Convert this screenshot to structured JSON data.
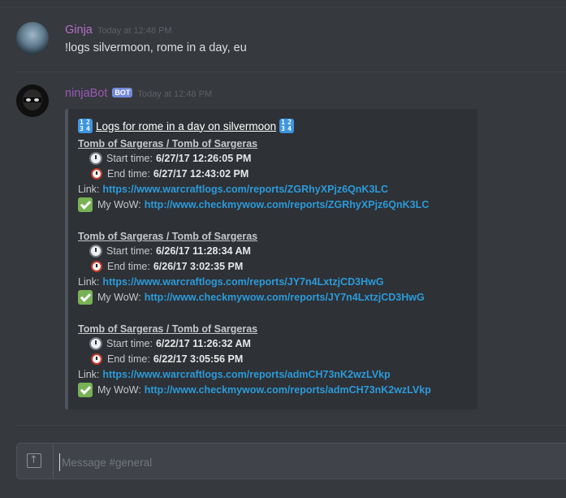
{
  "messages": [
    {
      "author": "Ginja",
      "timestamp": "Today at 12:48 PM",
      "text": "!logs silvermoon, rome in a day, eu"
    },
    {
      "author": "ninjaBot",
      "bot_tag": "BOT",
      "timestamp": "Today at 12:48 PM"
    }
  ],
  "embed": {
    "title": "Logs for rome in a day on silvermoon",
    "title_icon": "input-numbers-icon",
    "title_icon_digits": [
      "1",
      "2",
      "3",
      "4"
    ],
    "start_label": "Start time:",
    "end_label": "End time:",
    "link_label": "Link:",
    "mywow_label": "My WoW:",
    "sections": [
      {
        "title": "Tomb of Sargeras / Tomb of Sargeras",
        "start_time": "6/27/17 12:26:05 PM",
        "end_time": "6/27/17 12:43:02 PM",
        "link": "https://www.warcraftlogs.com/reports/ZGRhyXPjz6QnK3LC",
        "mywow": "http://www.checkmywow.com/reports/ZGRhyXPjz6QnK3LC"
      },
      {
        "title": "Tomb of Sargeras / Tomb of Sargeras",
        "start_time": "6/26/17 11:28:34 AM",
        "end_time": "6/26/17 3:02:35 PM",
        "link": "https://www.warcraftlogs.com/reports/JY7n4LxtzjCD3HwG",
        "mywow": "http://www.checkmywow.com/reports/JY7n4LxtzjCD3HwG"
      },
      {
        "title": "Tomb of Sargeras / Tomb of Sargeras",
        "start_time": "6/22/17 11:26:32 AM",
        "end_time": "6/22/17 3:05:56 PM",
        "link": "https://www.warcraftlogs.com/reports/admCH73nK2wzLVkp",
        "mywow": "http://www.checkmywow.com/reports/admCH73nK2wzLVkp"
      }
    ]
  },
  "composer": {
    "placeholder": "Message #general"
  },
  "colors": {
    "background": "#36393e",
    "link": "#2c9ad8",
    "bot_tag": "#7289da",
    "author_ginja": "#b571c9",
    "author_bot": "#9b59b6"
  }
}
